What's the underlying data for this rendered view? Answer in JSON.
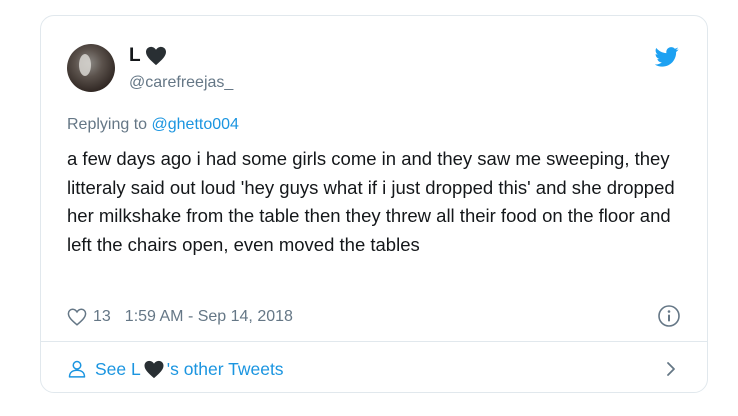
{
  "tweet": {
    "display_name": "L",
    "handle": "@carefreejas_",
    "reply_prefix": "Replying to ",
    "reply_to": "@ghetto004",
    "text": "a few days ago i had some girls come in and they saw me sweeping, they litteraly said out loud 'hey guys what if i just dropped this' and she dropped her milkshake from the table then they threw all their food on the floor and left the chairs open, even moved the tables",
    "like_count": "13",
    "timestamp": "1:59 AM - Sep 14, 2018"
  },
  "footer": {
    "prefix": "See L",
    "suffix": "'s other Tweets"
  },
  "colors": {
    "link": "#1b95e0",
    "secondary_text": "#657786",
    "border": "#e1e8ed",
    "heart_emoji": "#292f33"
  },
  "icons": [
    "black-heart-icon",
    "twitter-bird-icon",
    "like-heart-icon",
    "info-icon",
    "user-icon",
    "chevron-right-icon"
  ]
}
